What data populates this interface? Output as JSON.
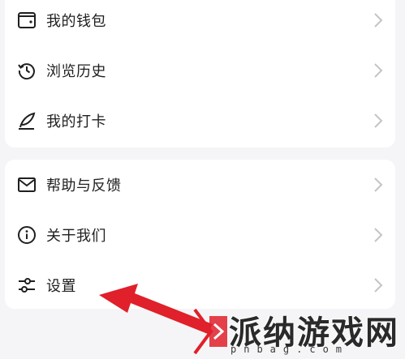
{
  "menu_top": {
    "items": [
      {
        "label": "我的钱包",
        "icon": "wallet-icon"
      },
      {
        "label": "浏览历史",
        "icon": "history-icon"
      },
      {
        "label": "我的打卡",
        "icon": "feather-icon"
      }
    ]
  },
  "menu_bottom": {
    "items": [
      {
        "label": "帮助与反馈",
        "icon": "mail-icon"
      },
      {
        "label": "关于我们",
        "icon": "info-icon"
      },
      {
        "label": "设置",
        "icon": "sliders-icon"
      }
    ]
  },
  "watermark": {
    "title": "派纳游戏网",
    "domain": "pnbag.com"
  },
  "colors": {
    "background": "#f5f5f7",
    "card": "#ffffff",
    "text": "#1f1f1f",
    "chevron": "#c4c4c4",
    "arrow": "#e0202a"
  }
}
